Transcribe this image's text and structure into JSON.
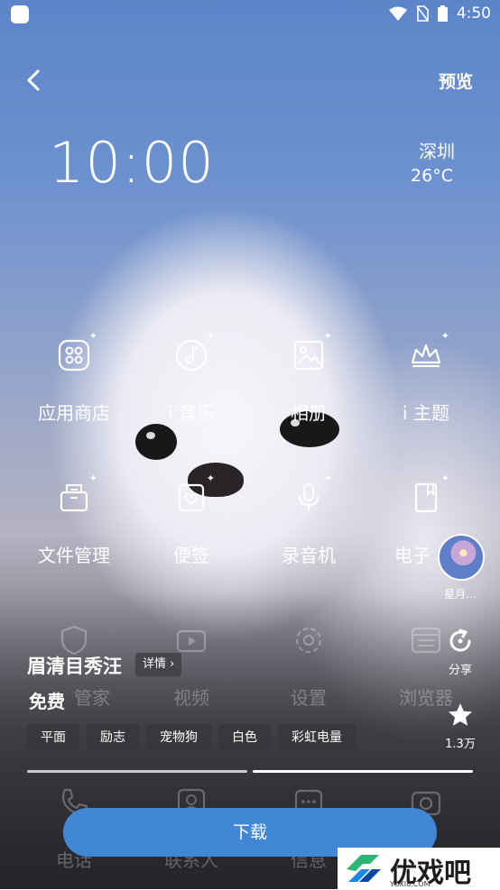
{
  "status_bar": {
    "time": "4:50"
  },
  "header": {
    "preview_label": "预览"
  },
  "lockscreen": {
    "clock": "10:00",
    "city": "深圳",
    "temperature": "26°C"
  },
  "apps": [
    {
      "label": "应用商店",
      "icon": "app-store-icon"
    },
    {
      "label": "i 音乐",
      "icon": "music-icon"
    },
    {
      "label": "相册",
      "icon": "gallery-icon"
    },
    {
      "label": "i 主题",
      "icon": "theme-crown-icon"
    },
    {
      "label": "文件管理",
      "icon": "file-manager-icon"
    },
    {
      "label": "便签",
      "icon": "notes-icon"
    },
    {
      "label": "录音机",
      "icon": "recorder-icon"
    },
    {
      "label": "电子",
      "icon": "ebook-icon"
    },
    {
      "label": "管家",
      "icon": "manager-icon"
    },
    {
      "label": "视频",
      "icon": "video-icon"
    },
    {
      "label": "设置",
      "icon": "settings-icon"
    },
    {
      "label": "浏览器",
      "icon": "browser-icon"
    },
    {
      "label": "电话",
      "icon": "phone-icon"
    },
    {
      "label": "联系人",
      "icon": "contacts-icon"
    },
    {
      "label": "信息",
      "icon": "messages-icon"
    },
    {
      "label": "",
      "icon": "camera-icon"
    }
  ],
  "author": {
    "name": "星月…"
  },
  "actions": {
    "share_label": "分享",
    "favorite_count": "1.3万"
  },
  "theme": {
    "title": "眉清目秀汪",
    "detail_label": "详情",
    "price": "免费",
    "tags": [
      "平面",
      "励志",
      "宠物狗",
      "白色",
      "彩虹电量"
    ]
  },
  "download_label": "下载",
  "watermark": {
    "text": "优戏吧",
    "url": "YOXI8.COM"
  },
  "colors": {
    "accent": "#4187d6"
  }
}
